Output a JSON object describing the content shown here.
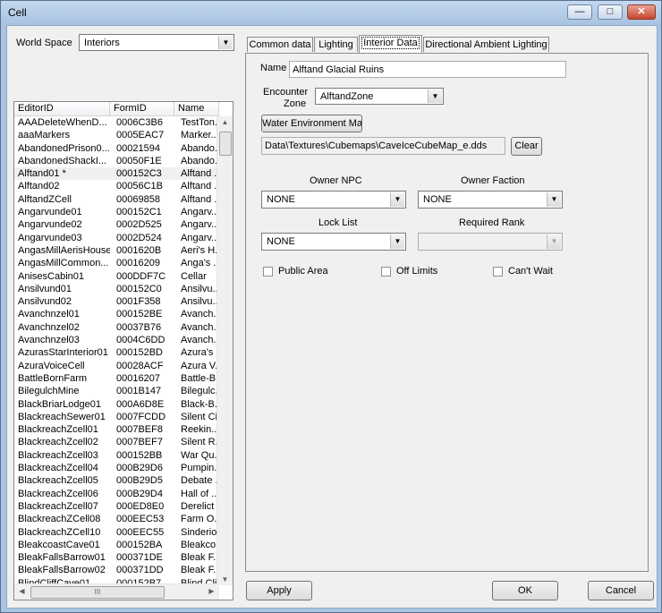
{
  "window": {
    "title": "Cell"
  },
  "left": {
    "world_space_label": "World Space",
    "world_space_value": "Interiors",
    "columns": [
      "EditorID",
      "FormID",
      "Name"
    ],
    "rows": [
      [
        "AAADeleteWhenD...",
        "0006C3B6",
        "TestTon..."
      ],
      [
        "aaaMarkers",
        "0005EAC7",
        "Marker..."
      ],
      [
        "AbandonedPrison0...",
        "00021594",
        "Abando..."
      ],
      [
        "AbandonedShackI...",
        "00050F1E",
        "Abando..."
      ],
      [
        "Alftand01 *",
        "000152C3",
        "Alftand ..."
      ],
      [
        "Alftand02",
        "00056C1B",
        "Alftand ..."
      ],
      [
        "AlftandZCell",
        "00069858",
        "Alftand ..."
      ],
      [
        "Angarvunde01",
        "000152C1",
        "Angarv..."
      ],
      [
        "Angarvunde02",
        "0002D525",
        "Angarv..."
      ],
      [
        "Angarvunde03",
        "0002D524",
        "Angarv..."
      ],
      [
        "AngasMillAerisHouse",
        "0001620B",
        "Aeri's H..."
      ],
      [
        "AngasMillCommon...",
        "00016209",
        "Anga's ..."
      ],
      [
        "AnisesCabin01",
        "000DDF7C",
        "Cellar"
      ],
      [
        "Ansilvund01",
        "000152C0",
        "Ansilvu..."
      ],
      [
        "Ansilvund02",
        "0001F358",
        "Ansilvu..."
      ],
      [
        "Avanchnzel01",
        "000152BE",
        "Avanch..."
      ],
      [
        "Avanchnzel02",
        "00037B76",
        "Avanch..."
      ],
      [
        "Avanchnzel03",
        "0004C6DD",
        "Avanch..."
      ],
      [
        "AzurasStarInterior01",
        "000152BD",
        "Azura's ..."
      ],
      [
        "AzuraVoiceCell",
        "00028ACF",
        "Azura V..."
      ],
      [
        "BattleBornFarm",
        "00016207",
        "Battle-B..."
      ],
      [
        "BilegulchMine",
        "0001B147",
        "Bilegulc..."
      ],
      [
        "BlackBriarLodge01",
        "000A6D8E",
        "Black-B..."
      ],
      [
        "BlackreachSewer01",
        "0007FCDD",
        "Silent Ci..."
      ],
      [
        "BlackreachZcell01",
        "0007BEF8",
        "Reekin..."
      ],
      [
        "BlackreachZcell02",
        "0007BEF7",
        "Silent R..."
      ],
      [
        "BlackreachZcell03",
        "000152BB",
        "War Qu..."
      ],
      [
        "BlackreachZcell04",
        "000B29D6",
        "Pumpin..."
      ],
      [
        "BlackreachZcell05",
        "000B29D5",
        "Debate ..."
      ],
      [
        "BlackreachZcell06",
        "000B29D4",
        "Hall of ..."
      ],
      [
        "BlackreachZcell07",
        "000ED8E0",
        "Derelict ..."
      ],
      [
        "BlackreachZCell08",
        "000EEC53",
        "Farm O..."
      ],
      [
        "BlackreachZCell10",
        "000EEC55",
        "Sinderio..."
      ],
      [
        "BleakcoastCave01",
        "000152BA",
        "Bleakco..."
      ],
      [
        "BleakFallsBarrow01",
        "000371DE",
        "Bleak F..."
      ],
      [
        "BleakFallsBarrow02",
        "000371DD",
        "Bleak F..."
      ],
      [
        "BlindCliffCave01",
        "000152B7",
        "Blind Cli..."
      ]
    ],
    "hscroll_grip": "III"
  },
  "tabs": [
    "Common data",
    "Lighting",
    "Interior Data",
    "Directional Ambient Lighting"
  ],
  "interior": {
    "name_label": "Name",
    "name_value": "Alftand Glacial Ruins",
    "encounter_zone_label_1": "Encounter",
    "encounter_zone_label_2": "Zone",
    "encounter_zone_value": "AlftandZone",
    "water_env_button": "Water Environment Ma",
    "cubemap_path": "Data\\Textures\\Cubemaps\\CaveIceCubeMap_e.dds",
    "clear_button": "Clear",
    "owner_npc_label": "Owner NPC",
    "owner_npc_value": "NONE",
    "owner_faction_label": "Owner Faction",
    "owner_faction_value": "NONE",
    "lock_list_label": "Lock List",
    "lock_list_value": "NONE",
    "required_rank_label": "Required Rank",
    "required_rank_value": "",
    "public_area_label": "Public Area",
    "off_limits_label": "Off Limits",
    "cant_wait_label": "Can't Wait"
  },
  "footer": {
    "apply": "Apply",
    "ok": "OK",
    "cancel": "Cancel"
  },
  "colors": {
    "frame": "#a9c4e2",
    "face": "#f0f0f0",
    "close": "#c8452e"
  }
}
